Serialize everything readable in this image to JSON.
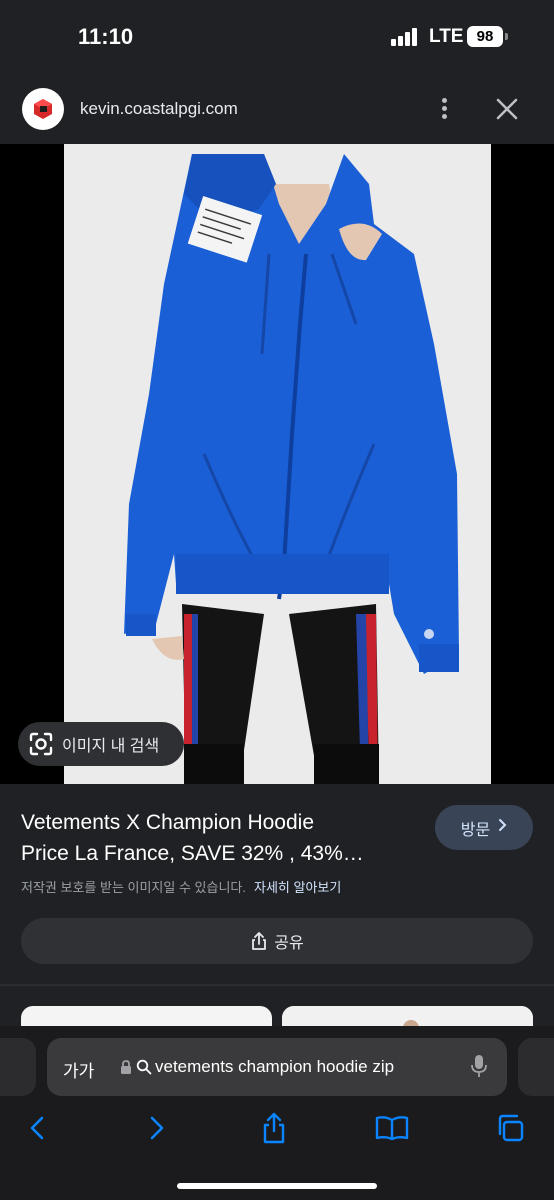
{
  "status": {
    "time": "11:10",
    "network": "LTE",
    "battery": "98"
  },
  "browser_header": {
    "url": "kevin.coastalpgi.com"
  },
  "image_viewer": {
    "lens_label": "이미지 내 검색"
  },
  "result": {
    "title_line1": "Vetements X Champion Hoodie",
    "title_line2": "Price La France, SAVE 32% , 43%…",
    "visit_label": "방문",
    "copyright_note": "저작권 보호를 받는 이미지일 수 있습니다.",
    "details_link": "자세히 알아보기",
    "share_label": "공유"
  },
  "address_bar": {
    "font_size_label": "가가",
    "query": "vetements champion hoodie zip"
  },
  "colors": {
    "background": "#202124",
    "hoodie_blue": "#1b5fd6",
    "visit_button": "#394457",
    "share_button": "#303134"
  }
}
